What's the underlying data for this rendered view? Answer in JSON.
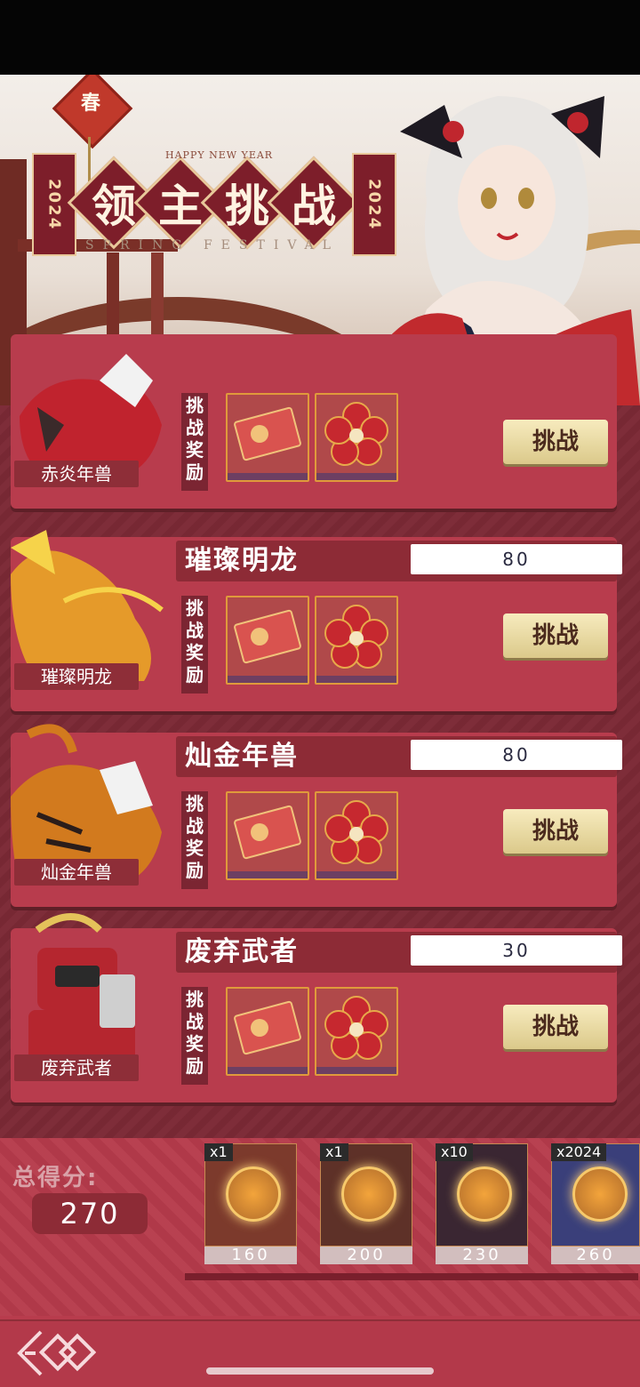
{
  "banner": {
    "charm_text": "春",
    "title_chars": [
      "领",
      "主",
      "挑",
      "战"
    ],
    "year_left": "2024",
    "year_right": "2024",
    "sub_top": "HAPPY NEW YEAR",
    "sub_bottom": "SPRING FESTIVAL"
  },
  "bosses": [
    {
      "name": "赤炎年兽",
      "score": "",
      "reward_label": "挑战奖励",
      "button": "挑战",
      "accent": "#c0232e"
    },
    {
      "name": "璀璨明龙",
      "score": "80",
      "reward_label": "挑战奖励",
      "button": "挑战",
      "accent": "#e8a23a"
    },
    {
      "name": "灿金年兽",
      "score": "80",
      "reward_label": "挑战奖励",
      "button": "挑战",
      "accent": "#d27a1e"
    },
    {
      "name": "废弃武者",
      "score": "30",
      "reward_label": "挑战奖励",
      "button": "挑战",
      "accent": "#b5262f"
    }
  ],
  "total": {
    "label": "总得分:",
    "value": "270"
  },
  "milestones": [
    {
      "count": "x1",
      "points": "160"
    },
    {
      "count": "x1",
      "points": "200"
    },
    {
      "count": "x10",
      "points": "230"
    },
    {
      "count": "x2024",
      "points": "260"
    }
  ],
  "colors": {
    "panel": "#b83c4d",
    "panel_dark": "#8d2b36",
    "button": "#efe1a8",
    "slot_border": "#e09a3b"
  }
}
